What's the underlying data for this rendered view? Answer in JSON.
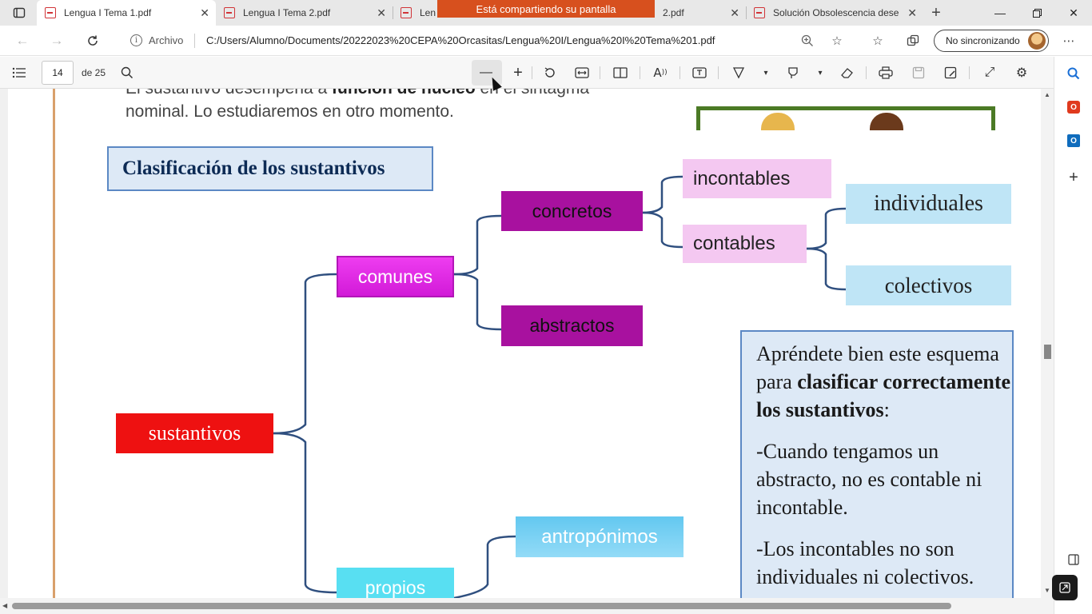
{
  "tabs": [
    {
      "label": "Lengua I Tema 1.pdf",
      "active": true
    },
    {
      "label": "Lengua I Tema 2.pdf",
      "active": false
    },
    {
      "label": "Len",
      "active": false
    },
    {
      "label": "2.pdf",
      "active": false
    },
    {
      "label": "Solución Obsolescencia dese",
      "active": false
    }
  ],
  "share_banner": "Está compartiendo su pantalla",
  "address": {
    "label": "Archivo",
    "url": "C:/Users/Alumno/Documents/20222023%20CEPA%20Orcasitas/Lengua%20I/Lengua%20I%20Tema%201.pdf",
    "sync_label": "No sincronizando"
  },
  "pdf_toolbar": {
    "page_current": "14",
    "page_total": "de 25"
  },
  "document": {
    "para_line1_before": "El sustantivo desempeña a ",
    "para_line1_bold": "función de núcleo",
    "para_line1_after": " en el sintagma",
    "para_line2": "nominal. Lo estudiaremos en otro momento.",
    "classification_title": "Clasificación de los sustantivos",
    "nodes": {
      "sustantivos": "sustantivos",
      "comunes": "comunes",
      "concretos": "concretos",
      "abstractos": "abstractos",
      "incontables": "incontables",
      "contables": "contables",
      "individuales": "individuales",
      "colectivos": "colectivos",
      "antroponimos": "antropónimos",
      "propios": "propios"
    },
    "note": {
      "p1_a": "Apréndete bien este esquema para ",
      "p1_bold": "clasificar correctamente los sustantivos",
      "p1_end": ":",
      "p2": "-Cuando tengamos un abstracto, no es contable ni incontable.",
      "p3": "-Los incontables no son individuales ni colectivos."
    }
  },
  "colors": {
    "sustantivos": "#ee1111",
    "comunes": "#e032e6",
    "concretos_abstractos": "#a8119f",
    "contables": "#f4c8f1",
    "individuales": "#bfe5f6",
    "propios": "#58dff2",
    "tree_line": "#2f4f7f",
    "share_banner": "#d7501e"
  }
}
